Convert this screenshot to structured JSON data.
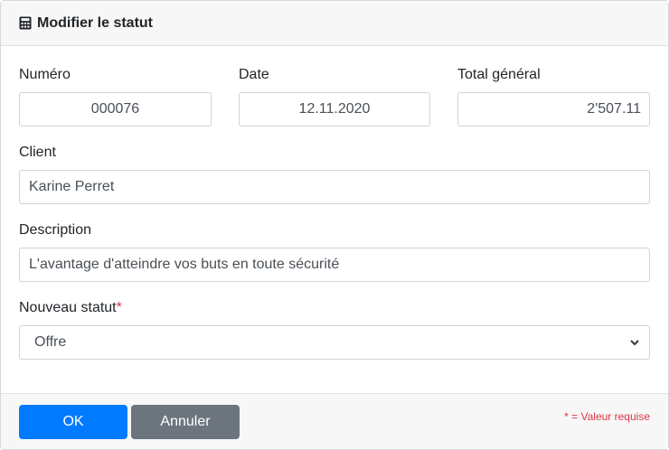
{
  "dialog": {
    "title": "Modifier le statut",
    "icon": "calculator-icon"
  },
  "form": {
    "numero": {
      "label": "Numéro",
      "value": "000076"
    },
    "date": {
      "label": "Date",
      "value": "12.11.2020"
    },
    "total": {
      "label": "Total général",
      "value": "2'507.11"
    },
    "client": {
      "label": "Client",
      "value": "Karine Perret"
    },
    "description": {
      "label": "Description",
      "value": "L'avantage d'atteindre vos buts en toute sécurité"
    },
    "statut": {
      "label": "Nouveau statut",
      "required_mark": "*",
      "selected": "Offre"
    }
  },
  "footer": {
    "ok_label": "OK",
    "cancel_label": "Annuler",
    "required_note": "* = Valeur requise"
  },
  "colors": {
    "primary": "#007bff",
    "secondary": "#6c757d",
    "danger": "#dc3545"
  }
}
